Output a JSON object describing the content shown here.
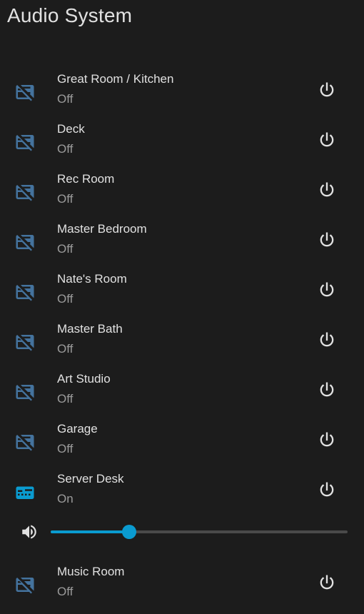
{
  "card": {
    "title": "Audio System"
  },
  "colors": {
    "icon_off": "#44739e",
    "icon_on": "#0a9bd0",
    "slider_fill": "#0a9bd0"
  },
  "zones": [
    {
      "name": "Great Room / Kitchen",
      "state": "Off",
      "icon": "speaker-off-icon"
    },
    {
      "name": "Deck",
      "state": "Off",
      "icon": "speaker-off-icon"
    },
    {
      "name": "Rec Room",
      "state": "Off",
      "icon": "speaker-off-icon"
    },
    {
      "name": "Master Bedroom",
      "state": "Off",
      "icon": "speaker-off-icon"
    },
    {
      "name": "Nate's Room",
      "state": "Off",
      "icon": "speaker-off-icon"
    },
    {
      "name": "Master Bath",
      "state": "Off",
      "icon": "speaker-off-icon"
    },
    {
      "name": "Art Studio",
      "state": "Off",
      "icon": "speaker-off-icon"
    },
    {
      "name": "Garage",
      "state": "Off",
      "icon": "speaker-off-icon"
    },
    {
      "name": "Server Desk",
      "state": "On",
      "icon": "speaker-icon"
    },
    {
      "name": "Music Room",
      "state": "Off",
      "icon": "speaker-off-icon"
    }
  ],
  "volume": {
    "icon": "volume-high-icon",
    "level_fraction": 0.265
  }
}
